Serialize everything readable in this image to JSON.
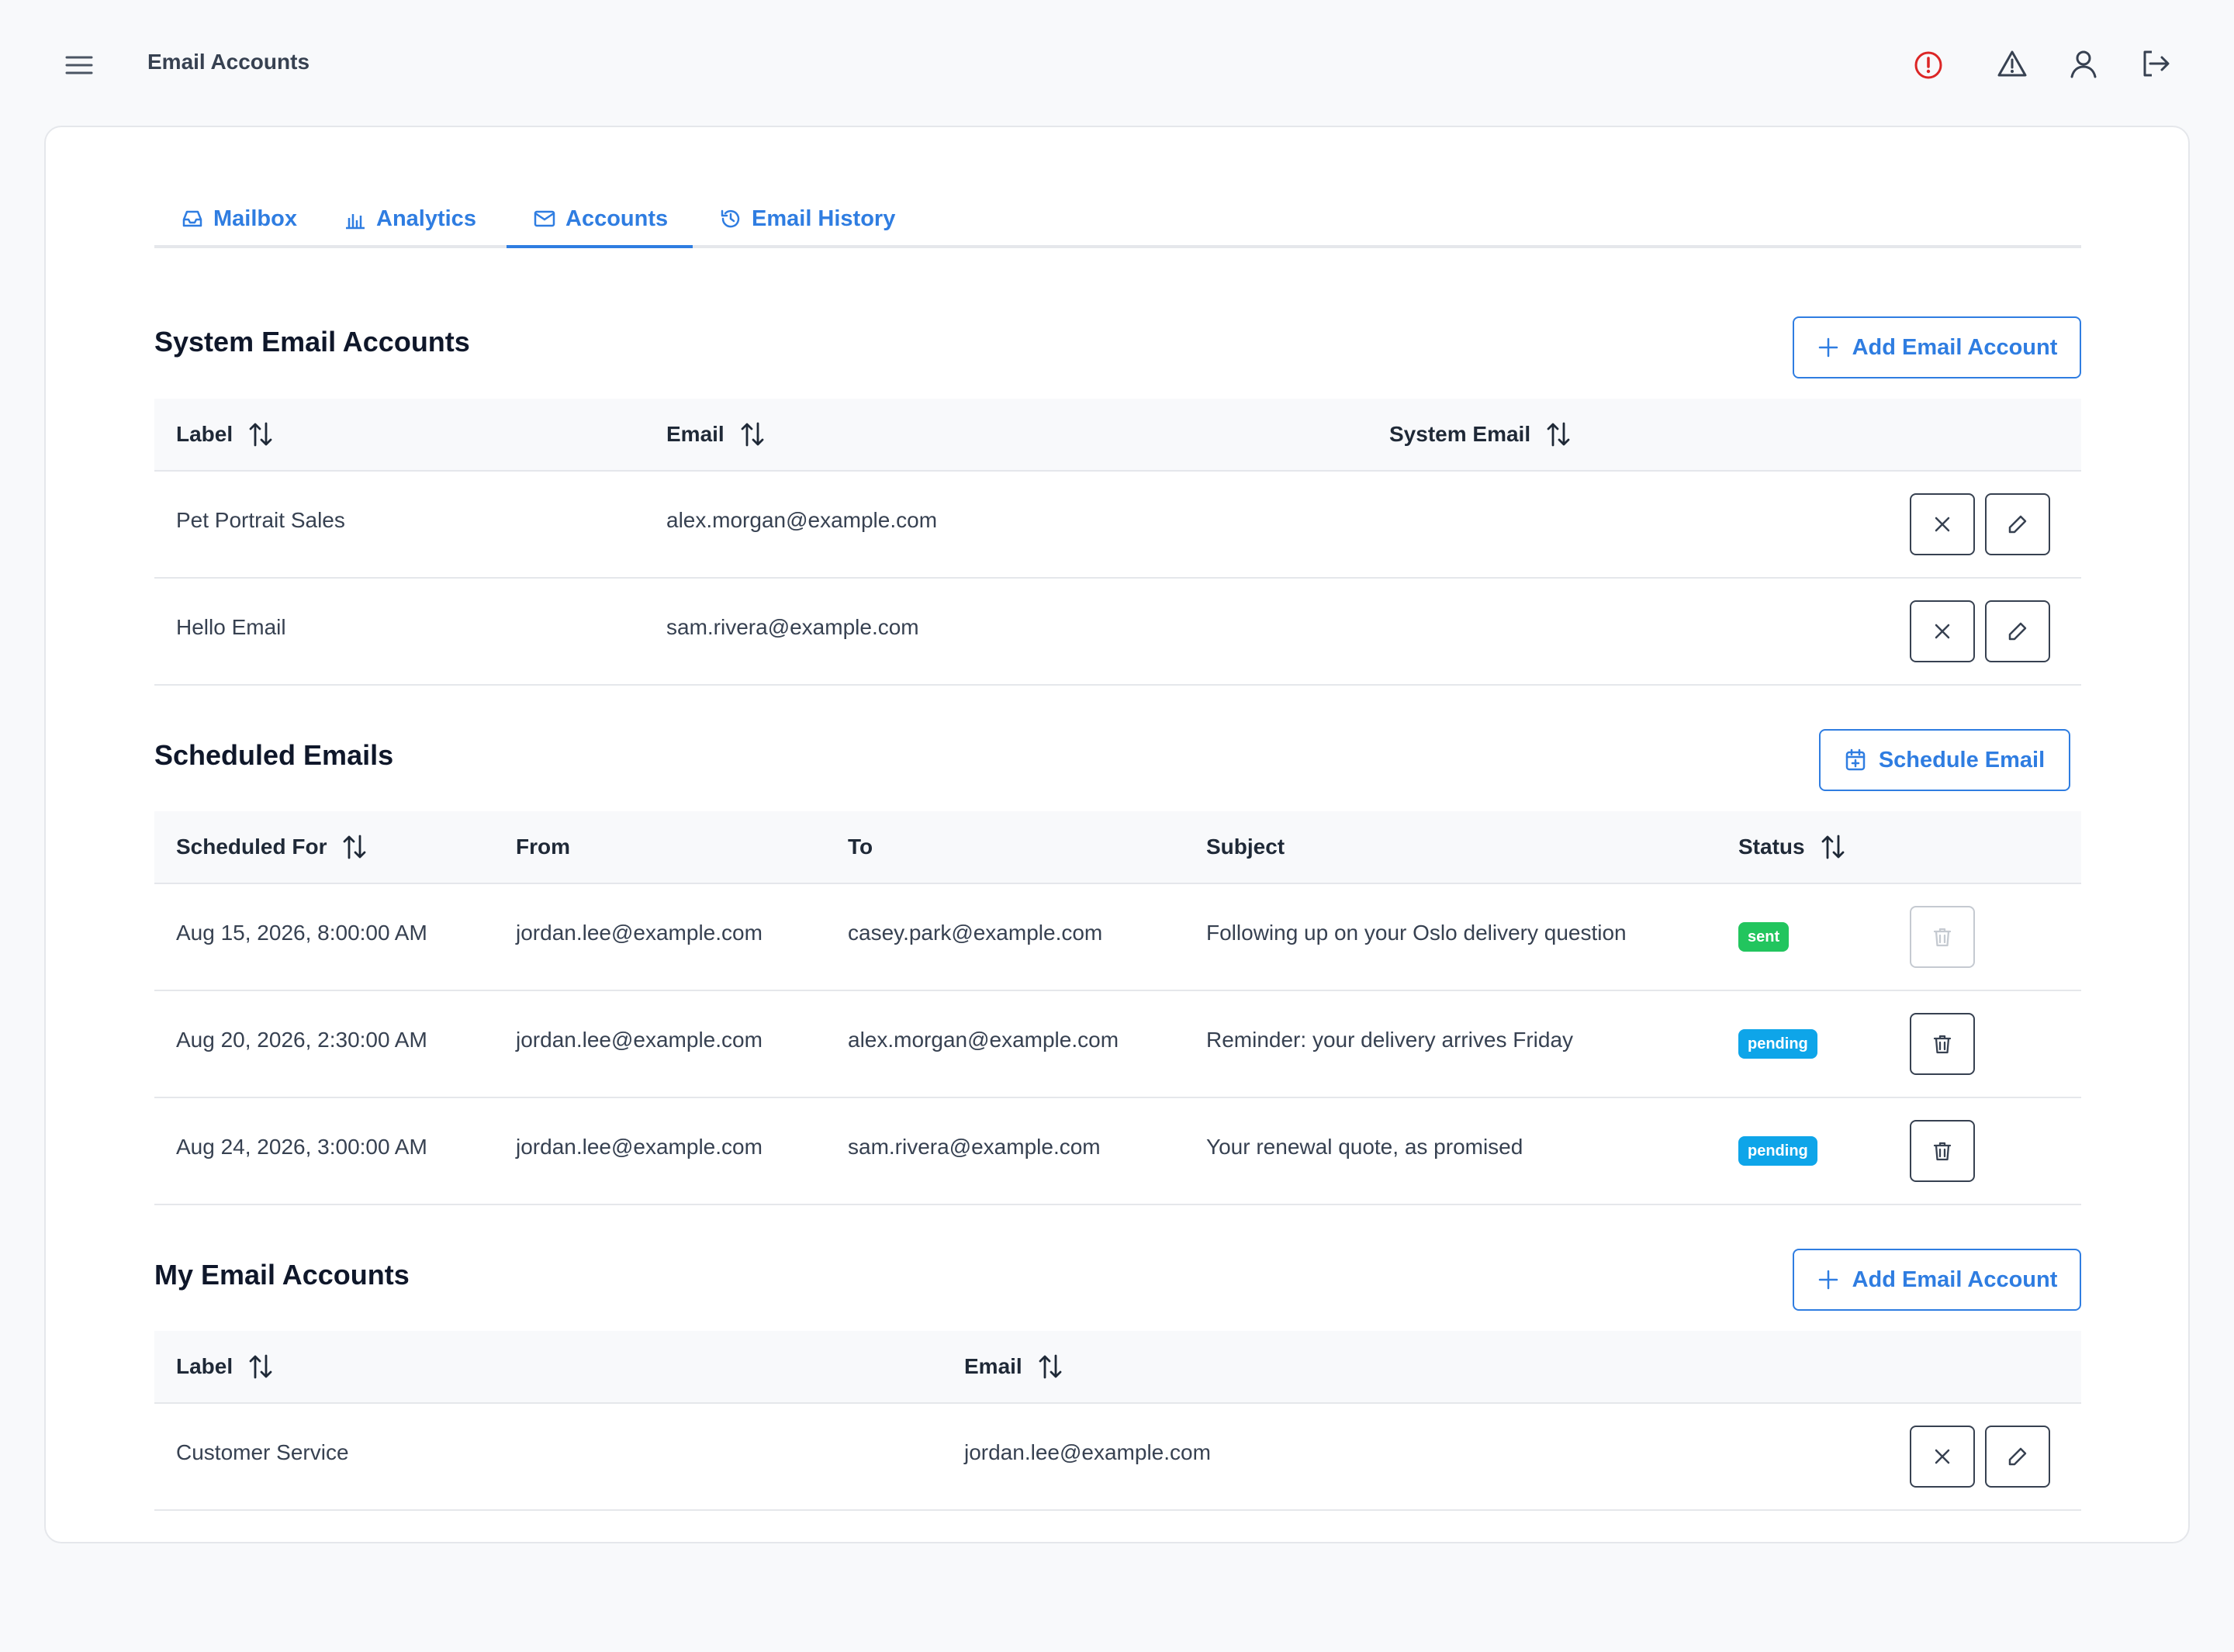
{
  "app": {
    "title": "Email Accounts"
  },
  "colors": {
    "accent": "#2f7de1",
    "sent": "#22c55e",
    "pending": "#0ea5e9",
    "alert": "#dc2626"
  },
  "header_icons": [
    "alert-circle-icon",
    "warning-triangle-icon",
    "user-icon",
    "logout-icon"
  ],
  "tabs": [
    {
      "label": "Mailbox",
      "icon": "inbox-icon",
      "active": false
    },
    {
      "label": "Analytics",
      "icon": "bar-chart-icon",
      "active": false
    },
    {
      "label": "Accounts",
      "icon": "envelope-icon",
      "active": true
    },
    {
      "label": "Email History",
      "icon": "history-icon",
      "active": false
    }
  ],
  "system_accounts": {
    "title": "System Email Accounts",
    "add_label": "Add Email Account",
    "columns": [
      "Label",
      "Email",
      "System Email"
    ],
    "rows": [
      {
        "label": "Pet Portrait Sales",
        "email": "alex.morgan@example.com",
        "system_email": ""
      },
      {
        "label": "Hello Email",
        "email": "sam.rivera@example.com",
        "system_email": ""
      }
    ]
  },
  "scheduled": {
    "title": "Scheduled Emails",
    "action_label": "Schedule Email",
    "columns": [
      "Scheduled For",
      "From",
      "To",
      "Subject",
      "Status"
    ],
    "rows": [
      {
        "scheduled_for": "Aug 15, 2026, 8:00:00 AM",
        "from": "jordan.lee@example.com",
        "to": "casey.park@example.com",
        "subject": "Following up on your Oslo delivery question",
        "status": "sent",
        "delete_enabled": false
      },
      {
        "scheduled_for": "Aug 20, 2026, 2:30:00 AM",
        "from": "jordan.lee@example.com",
        "to": "alex.morgan@example.com",
        "subject": "Reminder: your delivery arrives Friday",
        "status": "pending",
        "delete_enabled": true
      },
      {
        "scheduled_for": "Aug 24, 2026, 3:00:00 AM",
        "from": "jordan.lee@example.com",
        "to": "sam.rivera@example.com",
        "subject": "Your renewal quote, as promised",
        "status": "pending",
        "delete_enabled": true
      }
    ]
  },
  "my_accounts": {
    "title": "My Email Accounts",
    "add_label": "Add Email Account",
    "columns": [
      "Label",
      "Email"
    ],
    "rows": [
      {
        "label": "Customer Service",
        "email": "jordan.lee@example.com"
      }
    ]
  }
}
